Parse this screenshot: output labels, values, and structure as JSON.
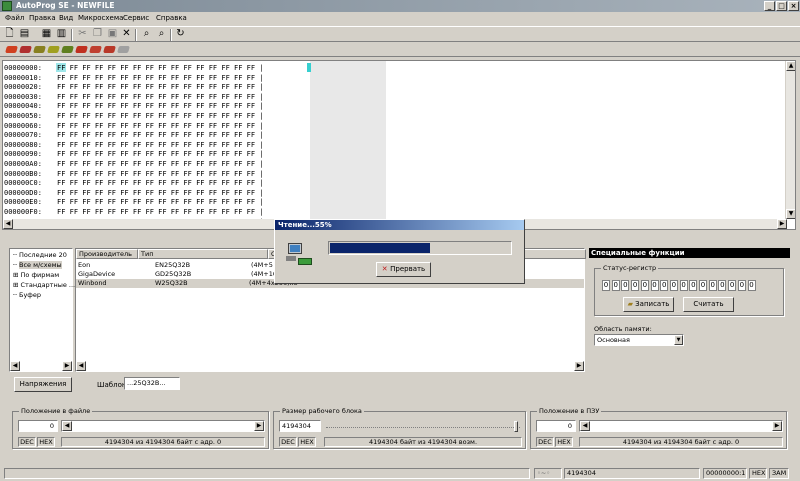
{
  "window": {
    "title": "AutoProg SE - NEWFILE"
  },
  "menu": [
    "Файл",
    "Правка",
    "Вид",
    "Микросхема",
    "Сервис",
    "Справка"
  ],
  "hex": {
    "addresses": [
      "00000000:",
      "00000010:",
      "00000020:",
      "00000030:",
      "00000040:",
      "00000050:",
      "00000060:",
      "00000070:",
      "00000080:",
      "00000090:",
      "000000A0:",
      "000000B0:",
      "000000C0:",
      "000000D0:",
      "000000E0:",
      "000000F0:",
      "00000100:"
    ],
    "row_bytes": "FF FF FF FF FF FF FF FF FF FF FF FF FF FF FF FF |"
  },
  "tree": {
    "items": [
      "Последние 20",
      "Все м/схемы",
      "По фирмам",
      "Стандартные ...",
      "Буфер"
    ]
  },
  "devices": {
    "columns": [
      "Производитель",
      "Тип",
      "О"
    ],
    "rows": [
      {
        "maker": "Eon",
        "type": "EN25Q32B",
        "size": "(4M+5"
      },
      {
        "maker": "GigaDevice",
        "type": "GD25Q32B",
        "size": "(4M+10"
      },
      {
        "maker": "Winbond",
        "type": "W25Q32B",
        "size": "(4M+4x256)x8"
      }
    ]
  },
  "dialog": {
    "title": "Чтение...55%",
    "progress": 0.55,
    "cancel_label": "Прервать"
  },
  "spec": {
    "title": "Специальные функции",
    "status_group": "Статус-регистр",
    "bits": [
      "0",
      "0",
      "0",
      "0",
      "0",
      "0",
      "0",
      "0",
      "0",
      "0",
      "0",
      "0",
      "0",
      "0",
      "0",
      "0"
    ],
    "write_label": "Записать",
    "read_label": "Считать",
    "memory_label": "Область памяти:",
    "memory_value": "Основная"
  },
  "lower": {
    "voltage_label": "Напряжения",
    "template_label": "Шаблон",
    "template_value": "...25Q32B..."
  },
  "file_pos": {
    "title": "Положение в файле",
    "value": "0",
    "dec": "DEC",
    "hex": "HEX",
    "status": "4194304 из 4194304 байт с адр. 0"
  },
  "block_size": {
    "title": "Размер рабочего блока",
    "value": "4194304",
    "dec": "DEC",
    "hex": "HEX",
    "status": "4194304 байт из 4194304 возм."
  },
  "rom_pos": {
    "title": "Положение в ПЗУ",
    "value": "0",
    "dec": "DEC",
    "hex": "HEX",
    "status": "4194304 из 4194304 байт с адр. 0"
  },
  "statusbar": {
    "size": "4194304",
    "address": "00000000:1",
    "mode": "HEX",
    "ins": "ЗАМ"
  }
}
